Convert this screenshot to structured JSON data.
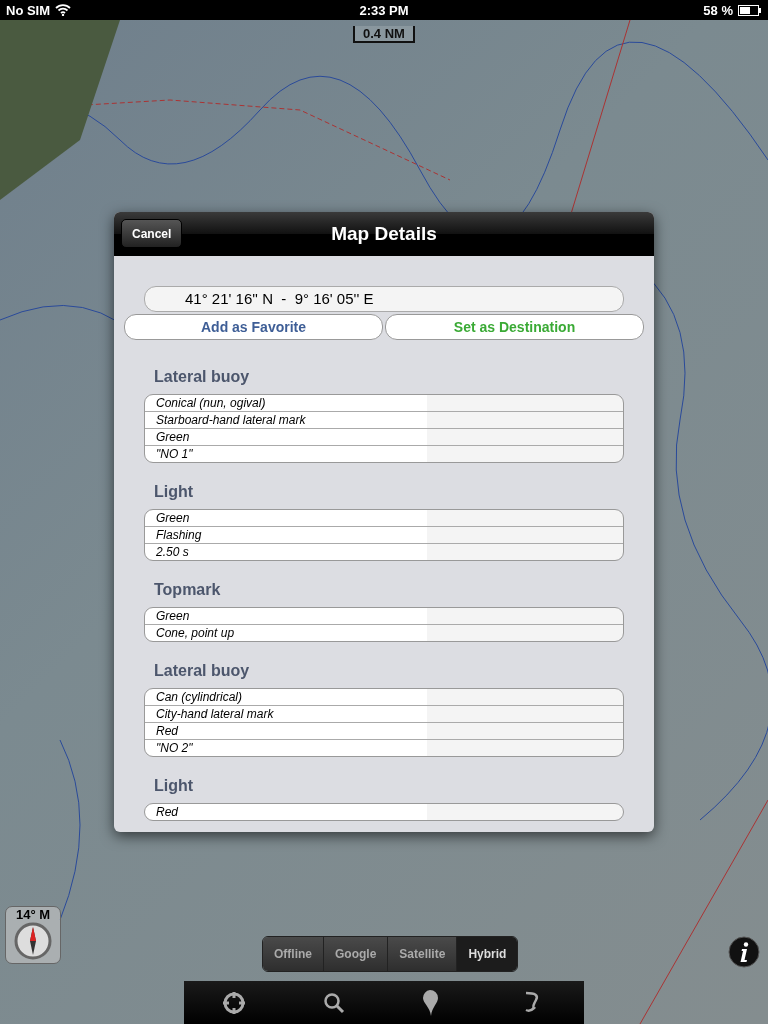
{
  "status_bar": {
    "carrier": "No SIM",
    "time": "2:33 PM",
    "battery": "58 %"
  },
  "map": {
    "scale": "0.4 NM"
  },
  "dialog": {
    "title": "Map Details",
    "cancel": "Cancel",
    "coordinates": "41° 21' 16'' N  -  9° 16' 05'' E",
    "buttons": [
      {
        "label": "Add as Favorite",
        "kind": "favorite"
      },
      {
        "label": "Set as Destination",
        "kind": "destination"
      }
    ],
    "sections": [
      {
        "title": "Lateral buoy",
        "rows": [
          "Conical (nun, ogival)",
          "Starboard-hand lateral mark",
          "Green",
          "\"NO 1\""
        ]
      },
      {
        "title": "Light",
        "rows": [
          "Green",
          "Flashing",
          "2.50 s"
        ]
      },
      {
        "title": "Topmark",
        "rows": [
          "Green",
          "Cone, point up"
        ]
      },
      {
        "title": "Lateral buoy",
        "rows": [
          "Can (cylindrical)",
          "City-hand lateral mark",
          "Red",
          "\"NO 2\""
        ]
      },
      {
        "title": "Light",
        "rows": [
          "Red"
        ]
      }
    ]
  },
  "compass": {
    "heading": "14° M"
  },
  "map_types": [
    {
      "label": "Offline",
      "selected": false
    },
    {
      "label": "Google",
      "selected": false
    },
    {
      "label": "Satellite",
      "selected": false
    },
    {
      "label": "Hybrid",
      "selected": true
    }
  ]
}
